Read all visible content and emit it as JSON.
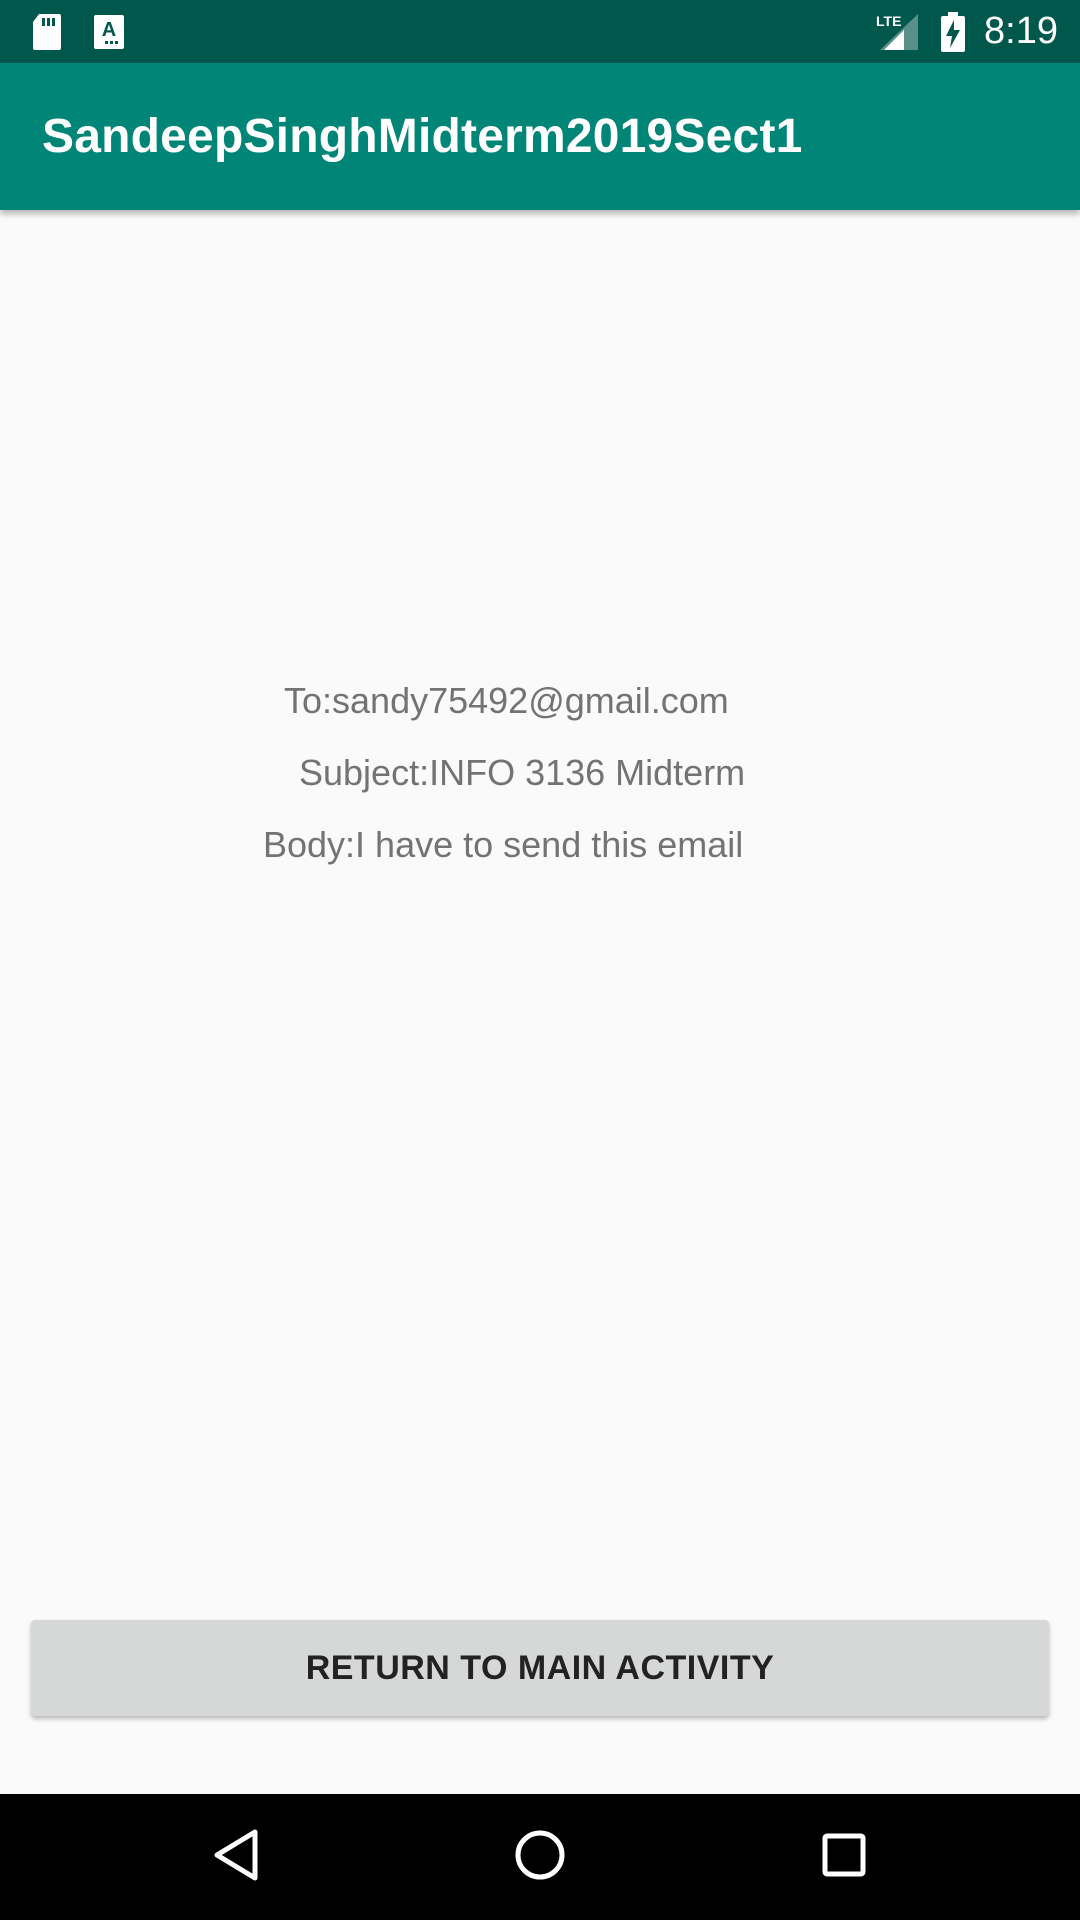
{
  "status_bar": {
    "time": "8:19",
    "network": "LTE",
    "icons": [
      "sd-card-icon",
      "a-notification-icon",
      "lte-signal-icon",
      "battery-charging-icon"
    ]
  },
  "app_bar": {
    "title": "SandeepSinghMidterm2019Sect1"
  },
  "email": {
    "to": "To:sandy75492@gmail.com",
    "subject": "Subject:INFO 3136 Midterm",
    "body": "Body:I have to send this email"
  },
  "actions": {
    "return_label": "RETURN TO MAIN ACTIVITY"
  },
  "nav_bar": {
    "icons": [
      "back-icon",
      "home-icon",
      "recents-icon"
    ]
  },
  "colors": {
    "status_bar": "#00574b",
    "app_bar": "#008577",
    "background": "#fafafa",
    "button": "#d6d7d7",
    "text": "#737373"
  }
}
